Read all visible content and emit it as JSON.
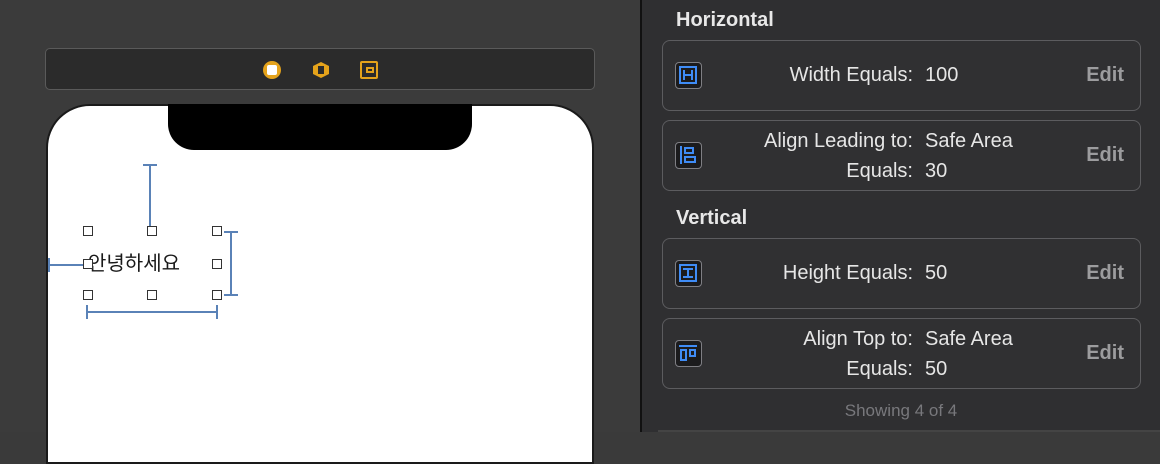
{
  "canvas": {
    "label_text": "안녕하세요",
    "scene_icons": [
      "view-controller-icon",
      "first-responder-icon",
      "exit-icon"
    ]
  },
  "inspector": {
    "horizontal_title": "Horizontal",
    "vertical_title": "Vertical",
    "constraints": [
      {
        "icon": "width-constraint-icon",
        "line1_label": "Width Equals:",
        "line1_value": "100",
        "edit_label": "Edit"
      },
      {
        "icon": "leading-constraint-icon",
        "line1_label": "Align Leading to:",
        "line1_value": "Safe Area",
        "line2_label": "Equals:",
        "line2_value": "30",
        "edit_label": "Edit"
      },
      {
        "icon": "height-constraint-icon",
        "line1_label": "Height Equals:",
        "line1_value": "50",
        "edit_label": "Edit"
      },
      {
        "icon": "top-constraint-icon",
        "line1_label": "Align Top to:",
        "line1_value": "Safe Area",
        "line2_label": "Equals:",
        "line2_value": "50",
        "edit_label": "Edit"
      }
    ],
    "footer_text": "Showing 4 of 4"
  },
  "colors": {
    "accent_blue": "#3f8cf6",
    "constraint_line": "#5a82b7",
    "scene_icon": "#e5a31b"
  }
}
